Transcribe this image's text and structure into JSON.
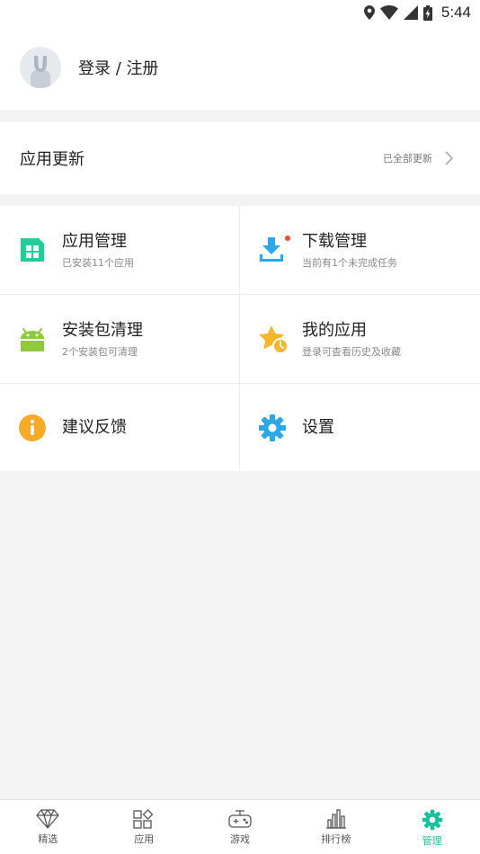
{
  "status_bar": {
    "time": "5:44",
    "icons": [
      "location-icon",
      "wifi-icon",
      "signal-icon",
      "battery-charging-icon"
    ]
  },
  "login": {
    "label": "登录 / 注册",
    "avatar_icon": "avatar-placeholder-icon"
  },
  "update": {
    "title": "应用更新",
    "status": "已全部更新",
    "icon": "chevron-right-icon"
  },
  "grid": {
    "items": [
      {
        "title": "应用管理",
        "subtitle": "已安装11个应用",
        "icon": "app-grid-icon",
        "color": "#1fcf9a"
      },
      {
        "title": "下载管理",
        "subtitle": "当前有1个未完成任务",
        "icon": "download-icon",
        "color": "#2ba8e8",
        "badge_color": "#f24a2e"
      },
      {
        "title": "安装包清理",
        "subtitle": "2个安装包可清理",
        "icon": "android-icon",
        "color": "#8fc93c"
      },
      {
        "title": "我的应用",
        "subtitle": "登录可查看历史及收藏",
        "icon": "star-clock-icon",
        "color": "#f7b52e"
      },
      {
        "title": "建议反馈",
        "subtitle": "",
        "icon": "info-icon",
        "color": "#f7a928"
      },
      {
        "title": "设置",
        "subtitle": "",
        "icon": "settings-icon",
        "color": "#2ba8e8"
      }
    ]
  },
  "bottom_nav": {
    "items": [
      {
        "label": "精选",
        "icon": "diamond-icon"
      },
      {
        "label": "应用",
        "icon": "apps-icon"
      },
      {
        "label": "游戏",
        "icon": "gamepad-icon"
      },
      {
        "label": "排行榜",
        "icon": "bar-chart-icon"
      },
      {
        "label": "管理",
        "icon": "gear-icon",
        "active": true
      }
    ],
    "active_color": "#15c19a",
    "inactive_color": "#555555"
  }
}
